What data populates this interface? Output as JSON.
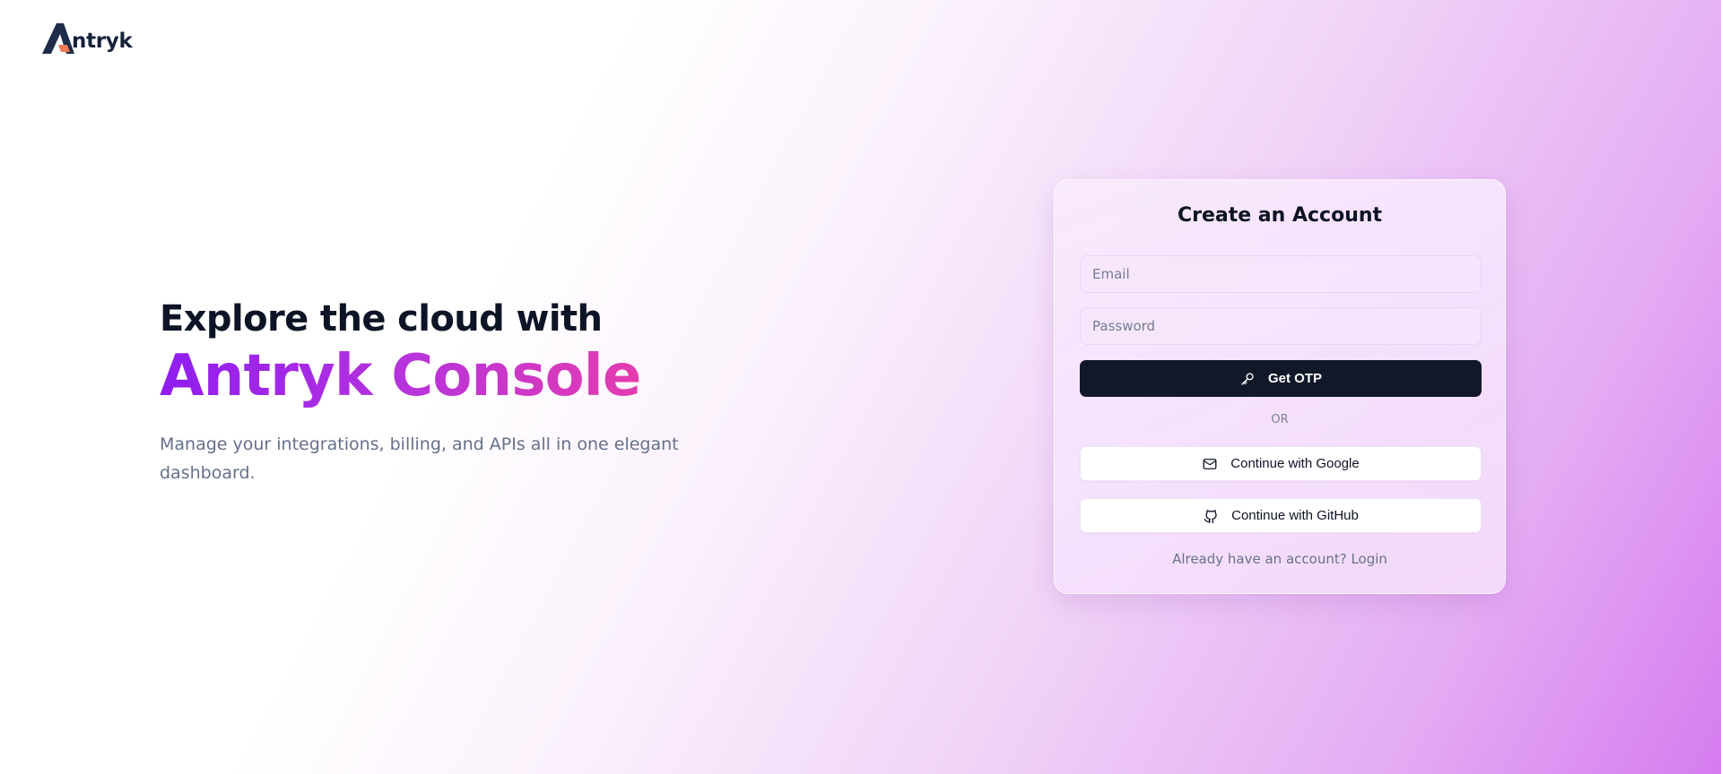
{
  "brand": {
    "name": "ntryk",
    "logo_letter": "A"
  },
  "hero": {
    "line1": "Explore the cloud with",
    "line2": "Antryk Console",
    "subtitle": "Manage your integrations, billing, and APIs all in one elegant dashboard."
  },
  "signup": {
    "title": "Create an Account",
    "email_placeholder": "Email",
    "password_placeholder": "Password",
    "otp_button": "Get OTP",
    "or_divider": "OR",
    "google_button": "Continue with Google",
    "github_button": "Continue with GitHub",
    "login_prompt": "Already have an account?",
    "login_link": "Login"
  },
  "icons": {
    "otp": "key-icon",
    "google": "mail-icon",
    "github": "github-icon"
  },
  "colors": {
    "primary_button": "#111827",
    "gradient_start": "#8f1df0",
    "gradient_end": "#ef3ea3"
  }
}
